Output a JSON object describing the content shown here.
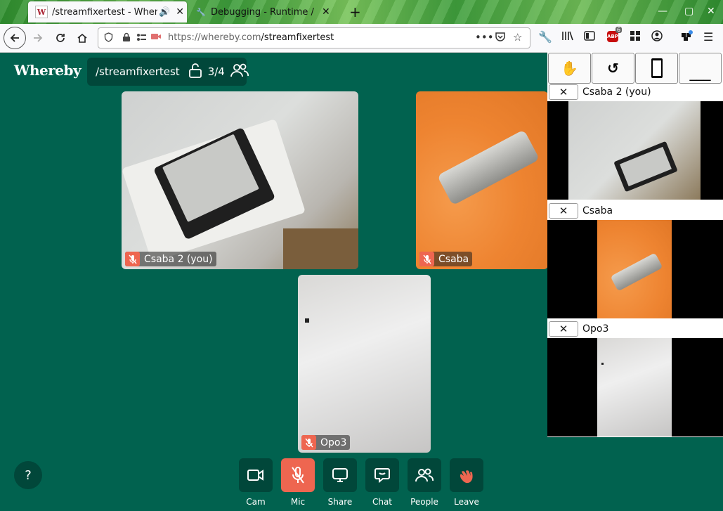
{
  "browser": {
    "tabs": [
      {
        "title": "/streamfixertest - Whereby",
        "favicon": "W",
        "active": true
      },
      {
        "title": "Debugging - Runtime / this-firefox",
        "active": false
      }
    ],
    "new_tab": "+",
    "url_host": "https://whereby.com",
    "url_path": "/streamfixertest",
    "abp_count": "6"
  },
  "app": {
    "logo": "Whereby",
    "room_name": "/streamfixertest",
    "participant_count": "3/4"
  },
  "tiles": [
    {
      "name": "Csaba 2 (you)",
      "muted": true
    },
    {
      "name": "Csaba",
      "muted": true
    },
    {
      "name": "Opo3",
      "muted": true
    }
  ],
  "help_label": "?",
  "controls": [
    {
      "id": "cam",
      "label": "Cam",
      "icon": "camera-icon"
    },
    {
      "id": "mic",
      "label": "Mic",
      "icon": "mic-off-icon",
      "active_red": true
    },
    {
      "id": "share",
      "label": "Share",
      "icon": "screen-share-icon"
    },
    {
      "id": "chat",
      "label": "Chat",
      "icon": "chat-icon"
    },
    {
      "id": "people",
      "label": "People",
      "icon": "people-icon"
    },
    {
      "id": "leave",
      "label": "Leave",
      "icon": "wave-hand-icon"
    }
  ],
  "panel": {
    "buttons": [
      "hand-icon",
      "rotate-icon",
      "phone-icon",
      "minimize-icon"
    ],
    "participants": [
      {
        "name": "Csaba 2 (you)"
      },
      {
        "name": "Csaba"
      },
      {
        "name": "Opo3"
      }
    ]
  },
  "colors": {
    "background": "#01624f",
    "pill": "#01473a",
    "mute_red": "#ee6650"
  }
}
